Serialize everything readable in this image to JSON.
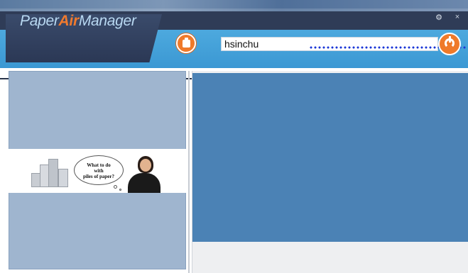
{
  "app": {
    "logo": {
      "part1": "Paper",
      "part2": "Air",
      "part3": "Manager"
    }
  },
  "header": {
    "search_value": "hsinchu",
    "settings_icon": "gear-icon",
    "close_icon": "close-icon",
    "close_glyph": "×",
    "settings_glyph": "⚙"
  },
  "promo": {
    "bubble_line1": "What to do",
    "bubble_line2": "with",
    "bubble_line3": "piles of paper?"
  },
  "colors": {
    "header_dark": "#2f3c57",
    "header_band": "#3b98d3",
    "accent_orange": "#ef7a2a",
    "left_pane": "#9fb5cf",
    "preview": "#4b82b5"
  }
}
